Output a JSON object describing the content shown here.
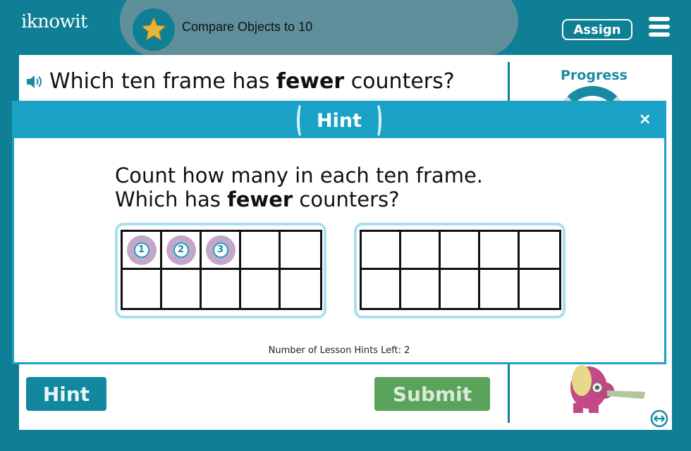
{
  "header": {
    "logo": "iknowit",
    "lesson_title": "Compare Objects to 10",
    "assign_label": "Assign",
    "star_icon": "star-icon",
    "menu_icon": "hamburger-menu-icon"
  },
  "question": {
    "prefix": "Which ten frame has ",
    "emphasis": "fewer",
    "suffix": " counters?",
    "speaker_icon": "speaker-icon"
  },
  "sidebar": {
    "progress_label": "Progress"
  },
  "buttons": {
    "hint_label": "Hint",
    "submit_label": "Submit"
  },
  "modal": {
    "title": "Hint",
    "close_label": "×",
    "line1": "Count how many in each ten frame.",
    "line2_prefix": "Which has ",
    "line2_emphasis": "fewer",
    "line2_suffix": " counters?",
    "hints_left_text": "Number of Lesson Hints Left: 2",
    "frames": [
      {
        "counters": [
          "1",
          "2",
          "3"
        ]
      },
      {
        "counters": []
      }
    ]
  },
  "colors": {
    "brand": "#0e7f95",
    "modal_accent": "#1aa1c6",
    "submit": "#5aa35a",
    "counter": "#c4a6c8"
  }
}
